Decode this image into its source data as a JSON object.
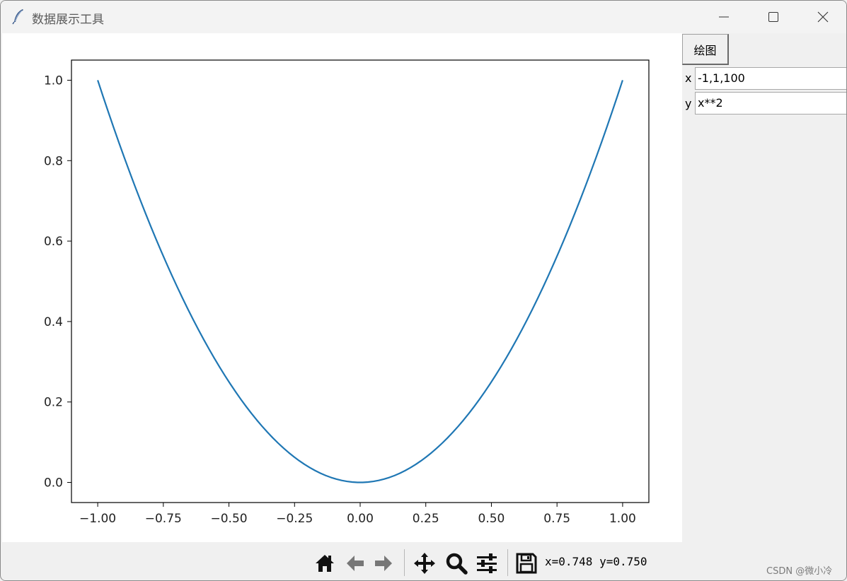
{
  "window": {
    "title": "数据展示工具"
  },
  "side_panel": {
    "plot_button_label": "绘图",
    "x_label": "x",
    "x_value": "-1,1,100",
    "y_label": "y",
    "y_value": "x**2"
  },
  "toolbar": {
    "icons": [
      "home-icon",
      "back-icon",
      "forward-icon",
      "pan-icon",
      "zoom-icon",
      "configure-subplots-icon",
      "save-icon"
    ],
    "coordinates": "x=0.748 y=0.750"
  },
  "watermark": "CSDN @微小冷",
  "chart_data": {
    "type": "line",
    "title": "",
    "xlabel": "",
    "ylabel": "",
    "xlim": [
      -1.1,
      1.1
    ],
    "ylim": [
      -0.05,
      1.05
    ],
    "x_ticks": [
      "−1.00",
      "−0.75",
      "−0.50",
      "−0.25",
      "0.00",
      "0.25",
      "0.50",
      "0.75",
      "1.00"
    ],
    "x_tick_values": [
      -1.0,
      -0.75,
      -0.5,
      -0.25,
      0.0,
      0.25,
      0.5,
      0.75,
      1.0
    ],
    "y_ticks": [
      "0.0",
      "0.2",
      "0.4",
      "0.6",
      "0.8",
      "1.0"
    ],
    "y_tick_values": [
      0.0,
      0.2,
      0.4,
      0.6,
      0.8,
      1.0
    ],
    "grid": false,
    "series": [
      {
        "color": "#1f77b4",
        "x_start": -1,
        "x_end": 1,
        "num_points": 100,
        "expression": "x**2"
      }
    ]
  }
}
